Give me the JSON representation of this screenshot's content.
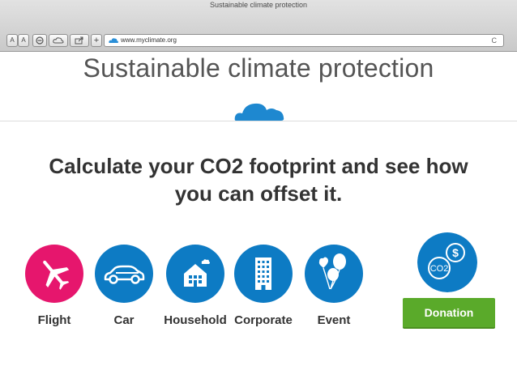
{
  "browser": {
    "window_title": "Sustainable climate protection",
    "font_buttons": [
      "A",
      "A"
    ],
    "add_tab_label": "+",
    "url": "www.myclimate.org",
    "reload_glyph": "C"
  },
  "site": {
    "title": "Sustainable climate protection",
    "brand_color": "#0d7bc4"
  },
  "headline": {
    "line1_pre": "Calculate your CO",
    "line1_sub": "2",
    "line1_post": " footprint and see how",
    "line2": "you can offset it."
  },
  "categories": [
    {
      "label": "Flight",
      "icon": "airplane-icon",
      "color": "#e6166d"
    },
    {
      "label": "Car",
      "icon": "car-icon",
      "color": "#0d7bc4"
    },
    {
      "label": "Household",
      "icon": "house-icon",
      "color": "#0d7bc4"
    },
    {
      "label": "Corporate",
      "icon": "building-icon",
      "color": "#0d7bc4"
    },
    {
      "label": "Event",
      "icon": "balloons-icon",
      "color": "#0d7bc4"
    }
  ],
  "donation": {
    "label": "Donation",
    "icon_text": "CO2",
    "icon_currency": "$",
    "button_color": "#5aaa2a"
  }
}
